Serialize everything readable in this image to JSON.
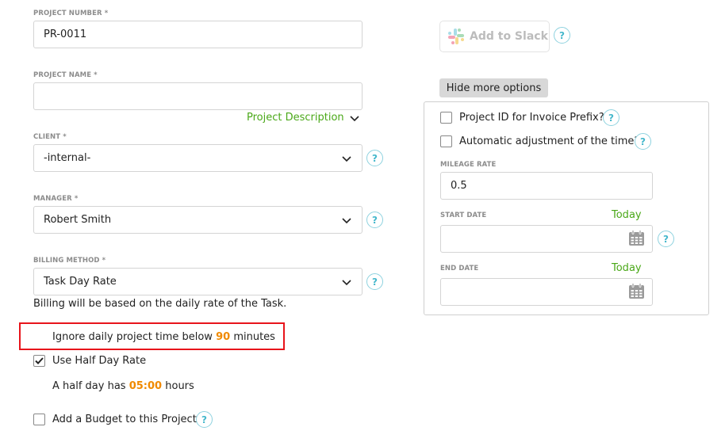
{
  "form": {
    "project_number": {
      "label": "PROJECT NUMBER *",
      "value": "PR-0011"
    },
    "project_name": {
      "label": "PROJECT NAME *",
      "value": ""
    },
    "project_description_link": "Project Description",
    "client": {
      "label": "CLIENT *",
      "value": "-internal-"
    },
    "manager": {
      "label": "MANAGER *",
      "value": "Robert Smith"
    },
    "billing_method": {
      "label": "BILLING METHOD *",
      "value": "Task Day Rate",
      "hint": "Billing will be based on the daily rate of the Task."
    },
    "ignore_time": {
      "prefix": "Ignore daily project time below",
      "value": "90",
      "suffix": "minutes"
    },
    "half_day_rate": {
      "label": "Use Half Day Rate",
      "checked": true
    },
    "half_day_hours": {
      "prefix": "A half day has",
      "value": "05:00",
      "suffix": "hours"
    },
    "budget": {
      "label": "Add a Budget to this Project",
      "checked": false
    }
  },
  "side": {
    "slack_button": "Add to Slack",
    "hide_options_button": "Hide more options",
    "invoice_prefix": {
      "label": "Project ID for Invoice Prefix?",
      "checked": false
    },
    "auto_adjust": {
      "label": "Automatic adjustment of the time?",
      "checked": false
    },
    "mileage_rate": {
      "label": "MILEAGE RATE",
      "value": "0.5"
    },
    "start_date": {
      "label": "START DATE",
      "today_link": "Today",
      "value": ""
    },
    "end_date": {
      "label": "END DATE",
      "today_link": "Today",
      "value": ""
    }
  },
  "help_glyph": "?",
  "colors": {
    "accent_green": "#4aa818",
    "highlight_orange": "#f08a00",
    "help_blue": "#46b8cc",
    "annotation_red": "#e8141b"
  }
}
